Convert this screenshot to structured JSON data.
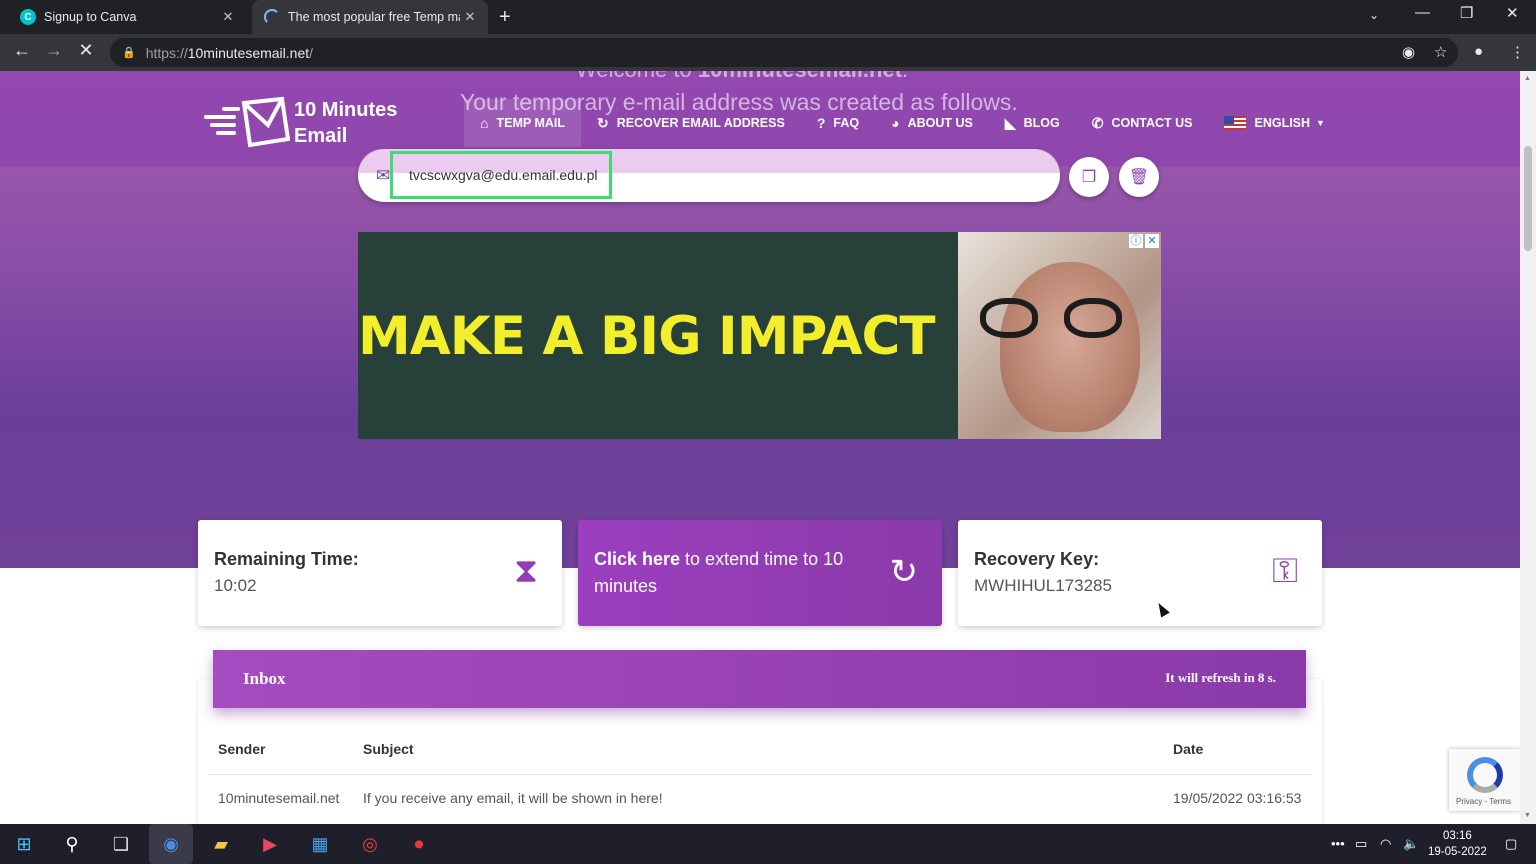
{
  "browser": {
    "tabs": [
      {
        "title": "Signup to Canva",
        "active": false
      },
      {
        "title": "The most popular free Temp ma",
        "active": true
      }
    ],
    "url_prefix": "https://",
    "url_host": "10minutesemail.net",
    "url_path": "/"
  },
  "site": {
    "welcome_prefix": "Welcome to ",
    "welcome_brand": "10minutesemail.net",
    "welcome_suffix": ".",
    "created_text": "Your temporary e-mail address was created as follows.",
    "logo_line1": "10 Minutes",
    "logo_line2": "Email",
    "nav": [
      {
        "label": "TEMP MAIL",
        "icon": "home-icon"
      },
      {
        "label": "RECOVER EMAIL ADDRESS",
        "icon": "refresh-icon"
      },
      {
        "label": "FAQ",
        "icon": "question-icon"
      },
      {
        "label": "ABOUT US",
        "icon": "user-icon"
      },
      {
        "label": "BLOG",
        "icon": "rss-icon"
      },
      {
        "label": "CONTACT US",
        "icon": "phone-icon"
      },
      {
        "label": "ENGLISH",
        "icon": "us-flag-icon"
      }
    ],
    "email_address": "tvcscwxgva@edu.email.edu.pl"
  },
  "ad": {
    "headline": "MAKE A BIG IMPACT"
  },
  "cards": {
    "remaining_label": "Remaining Time:",
    "remaining_value": "10:02",
    "extend_bold": "Click here",
    "extend_rest": " to extend time to 10 minutes",
    "recovery_label": "Recovery Key:",
    "recovery_value": "MWHIHUL173285"
  },
  "inbox": {
    "title": "Inbox",
    "refresh_text": "It will refresh in 8 s.",
    "columns": [
      "Sender",
      "Subject",
      "Date"
    ],
    "rows": [
      {
        "sender": "10minutesemail.net",
        "subject": "If you receive any email, it will be shown in here!",
        "date": "19/05/2022 03:16:53"
      }
    ]
  },
  "recaptcha": {
    "terms": "Privacy - Terms"
  },
  "taskbar": {
    "time": "03:16",
    "date": "19-05-2022"
  },
  "colors": {
    "brand_purple": "#8e3fb2",
    "highlight_green": "#3ddc6f",
    "ad_yellow": "#f2ee2c"
  }
}
